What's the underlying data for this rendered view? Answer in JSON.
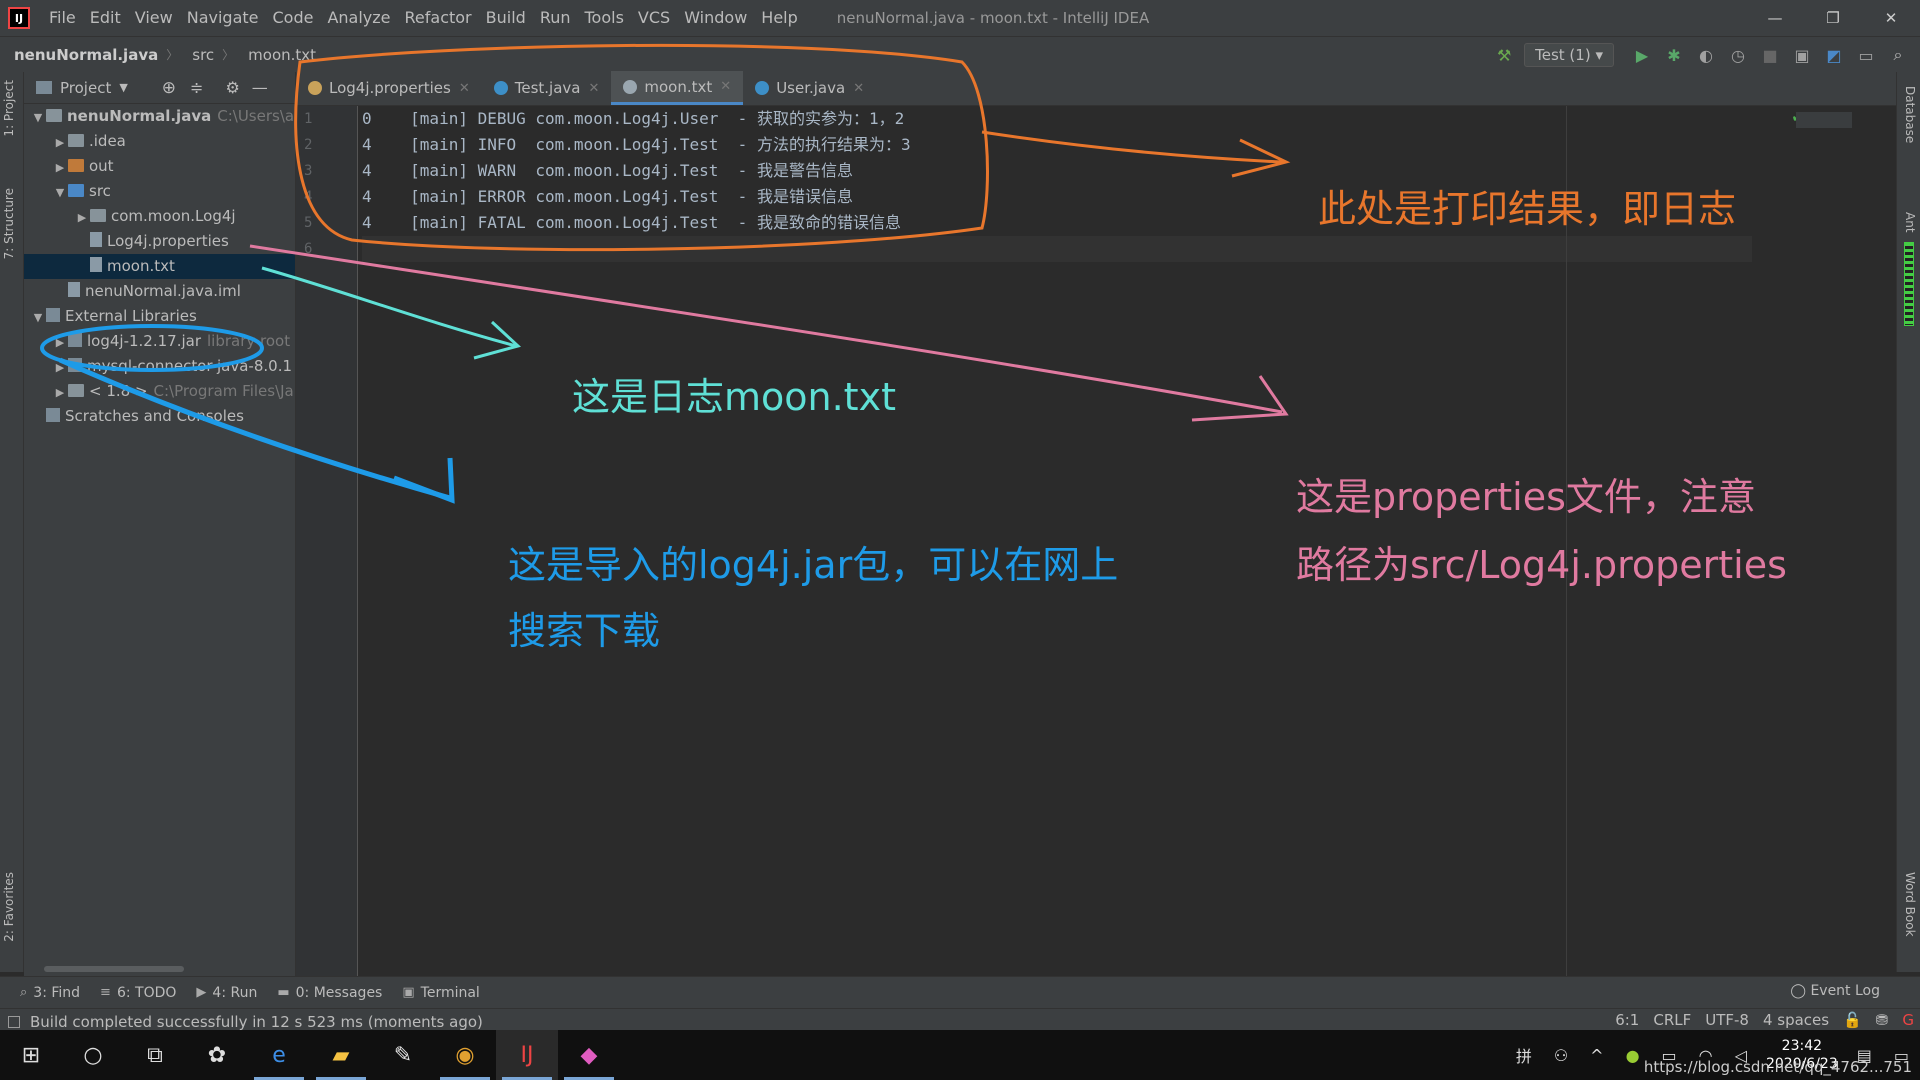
{
  "window": {
    "title": "nenuNormal.java - moon.txt - IntelliJ IDEA",
    "app_icon": "intellij-logo-icon",
    "controls": [
      "—",
      "❐",
      "✕"
    ]
  },
  "menu": [
    "File",
    "Edit",
    "View",
    "Navigate",
    "Code",
    "Analyze",
    "Refactor",
    "Build",
    "Run",
    "Tools",
    "VCS",
    "Window",
    "Help"
  ],
  "breadcrumb": {
    "project": "nenuNormal.java",
    "folder": "src",
    "file": "moon.txt"
  },
  "toolbar": {
    "run_config": "Test (1)"
  },
  "project_panel": {
    "label": "Project",
    "tree": [
      {
        "level": 0,
        "arrow": "▼",
        "icon": "folder",
        "label": "nenuNormal.java",
        "hint": "C:\\Users\\as",
        "bold": true
      },
      {
        "level": 1,
        "arrow": "▶",
        "icon": "folder",
        "label": ".idea",
        "hint": ""
      },
      {
        "level": 1,
        "arrow": "▶",
        "icon": "folder-orange",
        "label": "out",
        "hint": ""
      },
      {
        "level": 1,
        "arrow": "▼",
        "icon": "folder-blue",
        "label": "src",
        "hint": ""
      },
      {
        "level": 2,
        "arrow": "▶",
        "icon": "package",
        "label": "com.moon.Log4j",
        "hint": ""
      },
      {
        "level": 2,
        "arrow": "",
        "icon": "properties-file",
        "label": "Log4j.properties",
        "hint": ""
      },
      {
        "level": 2,
        "arrow": "",
        "icon": "text-file",
        "label": "moon.txt",
        "hint": "",
        "selected": true
      },
      {
        "level": 1,
        "arrow": "",
        "icon": "module-file",
        "label": "nenuNormal.java.iml",
        "hint": ""
      },
      {
        "level": 0,
        "arrow": "▼",
        "icon": "library",
        "label": "External Libraries",
        "hint": ""
      },
      {
        "level": 1,
        "arrow": "▶",
        "icon": "jar",
        "label": "log4j-1.2.17.jar",
        "hint": "library root"
      },
      {
        "level": 1,
        "arrow": "▶",
        "icon": "jar",
        "label": "mysql-connector-java-8.0.1",
        "hint": ""
      },
      {
        "level": 1,
        "arrow": "▶",
        "icon": "jdk",
        "label": "< 1.8 >",
        "hint": "C:\\Program Files\\Ja"
      },
      {
        "level": 0,
        "arrow": "",
        "icon": "scratches",
        "label": "Scratches and Consoles",
        "hint": ""
      }
    ]
  },
  "left_strip": {
    "project_tab": "1: Project",
    "structure_tab": "7: Structure",
    "favorites_tab": "2: Favorites"
  },
  "right_strip": {
    "database_tab": "Database",
    "ant_tab": "Ant",
    "wordbook_tab": "Word Book"
  },
  "editor_tabs": [
    {
      "label": "Log4j.properties",
      "icon_color": "#c9a25a",
      "active": false
    },
    {
      "label": "Test.java",
      "icon_color": "#3d8fc7",
      "active": false
    },
    {
      "label": "moon.txt",
      "icon_color": "#9aa7b0",
      "active": true
    },
    {
      "label": "User.java",
      "icon_color": "#3d8fc7",
      "active": false
    }
  ],
  "editor": {
    "line_numbers": [
      "1",
      "2",
      "3",
      "4",
      "5",
      "6"
    ],
    "lines": [
      "0    [main] DEBUG com.moon.Log4j.User  - 获取的实参为：1，2",
      "4    [main] INFO  com.moon.Log4j.Test  - 方法的执行结果为：3",
      "4    [main] WARN  com.moon.Log4j.Test  - 我是警告信息",
      "4    [main] ERROR com.moon.Log4j.Test  - 我是错误信息",
      "4    [main] FATAL com.moon.Log4j.Test  - 我是致命的错误信息",
      ""
    ]
  },
  "bottom_tabs": [
    {
      "icon": "search-icon",
      "label": "3: Find"
    },
    {
      "icon": "list-icon",
      "label": "6: TODO"
    },
    {
      "icon": "play-icon",
      "label": "4: Run"
    },
    {
      "icon": "message-icon",
      "label": "0: Messages"
    },
    {
      "icon": "terminal-icon",
      "label": "Terminal"
    }
  ],
  "event_log": "Event Log",
  "status": {
    "message": "Build completed successfully in 12 s 523 ms (moments ago)",
    "position": "6:1",
    "line_sep": "CRLF",
    "encoding": "UTF-8",
    "indent": "4 spaces"
  },
  "taskbar": {
    "time": "23:42",
    "date": "2020/6/23",
    "watermark": "https://blog.csdn.net/qq_4762...751"
  },
  "annotations": {
    "log_result": "此处是打印结果，即日志",
    "moon_txt": "这是日志moon.txt",
    "properties_line1": "这是properties文件，注意",
    "properties_line2": "路径为src/Log4j.properties",
    "jar_line1": "这是导入的log4j.jar包，可以在网上",
    "jar_line2": "搜索下载",
    "colors": {
      "orange": "#e8762c",
      "cyan": "#5fe0d6",
      "pink": "#e07aa0",
      "blue": "#1e9be8"
    }
  }
}
